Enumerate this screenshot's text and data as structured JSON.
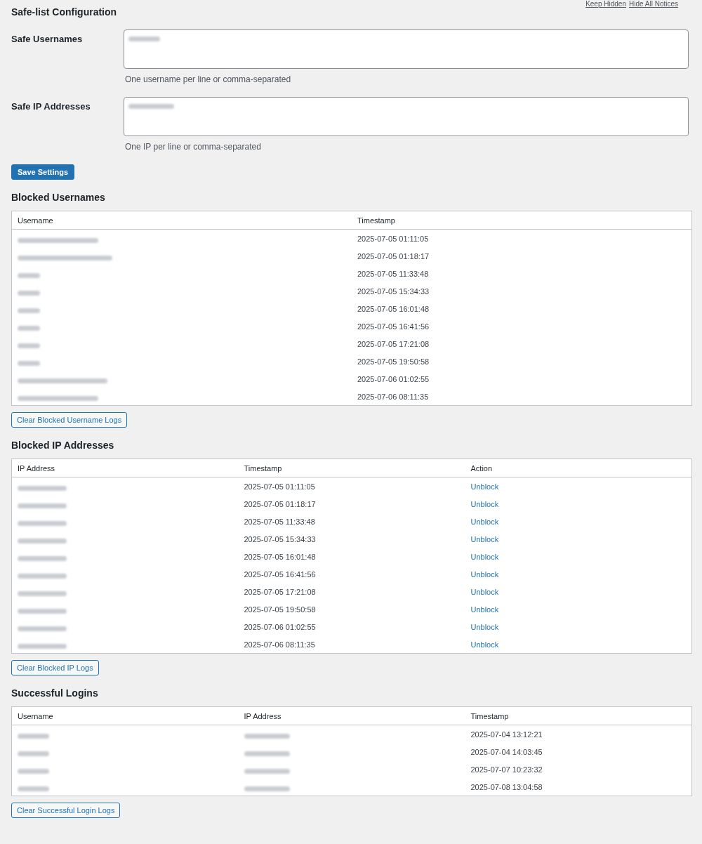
{
  "notices": [
    {
      "label": "Keep Hidden"
    },
    {
      "label": "Hide All Notices"
    }
  ],
  "title": "Safe-list Configuration",
  "fields": [
    {
      "label": "Safe Usernames",
      "hint": "One username per line or comma-separated"
    },
    {
      "label": "Safe IP Addresses",
      "hint": "One IP per line or comma-separated"
    }
  ],
  "save_button": "Save Settings",
  "sections": [
    {
      "title": "Blocked Usernames",
      "columns": [
        {
          "label": "Username",
          "kind": "redacted"
        },
        {
          "label": "Timestamp",
          "kind": "text"
        }
      ],
      "rows": [
        [
          "",
          "2025-07-05 01:11:05"
        ],
        [
          "",
          "2025-07-05 01:18:17"
        ],
        [
          "",
          "2025-07-05 11:33:48"
        ],
        [
          "",
          "2025-07-05 15:34:33"
        ],
        [
          "",
          "2025-07-05 16:01:48"
        ],
        [
          "",
          "2025-07-05 16:41:56"
        ],
        [
          "",
          "2025-07-05 17:21:08"
        ],
        [
          "",
          "2025-07-05 19:50:58"
        ],
        [
          "",
          "2025-07-06 01:02:55"
        ],
        [
          "",
          "2025-07-06 08:11:35"
        ]
      ],
      "button": "Clear Blocked Username Logs"
    },
    {
      "title": "Blocked IP Addresses",
      "columns": [
        {
          "label": "IP Address",
          "kind": "redacted"
        },
        {
          "label": "Timestamp",
          "kind": "text"
        },
        {
          "label": "Action",
          "kind": "link"
        }
      ],
      "rows": [
        [
          "",
          "2025-07-05 01:11:05",
          "Unblock"
        ],
        [
          "",
          "2025-07-05 01:18:17",
          "Unblock"
        ],
        [
          "",
          "2025-07-05 11:33:48",
          "Unblock"
        ],
        [
          "",
          "2025-07-05 15:34:33",
          "Unblock"
        ],
        [
          "",
          "2025-07-05 16:01:48",
          "Unblock"
        ],
        [
          "",
          "2025-07-05 16:41:56",
          "Unblock"
        ],
        [
          "",
          "2025-07-05 17:21:08",
          "Unblock"
        ],
        [
          "",
          "2025-07-05 19:50:58",
          "Unblock"
        ],
        [
          "",
          "2025-07-06 01:02:55",
          "Unblock"
        ],
        [
          "",
          "2025-07-06 08:11:35",
          "Unblock"
        ]
      ],
      "button": "Clear Blocked IP Logs"
    },
    {
      "title": "Successful Logins",
      "columns": [
        {
          "label": "Username",
          "kind": "redacted"
        },
        {
          "label": "IP Address",
          "kind": "redacted"
        },
        {
          "label": "Timestamp",
          "kind": "text"
        }
      ],
      "rows": [
        [
          "",
          "",
          "2025-07-04 13:12:21"
        ],
        [
          "",
          "",
          "2025-07-04 14:03:45"
        ],
        [
          "",
          "",
          "2025-07-07 10:23:32"
        ],
        [
          "",
          "",
          "2025-07-08 13:04:58"
        ]
      ],
      "button": "Clear Successful Login Logs"
    }
  ]
}
